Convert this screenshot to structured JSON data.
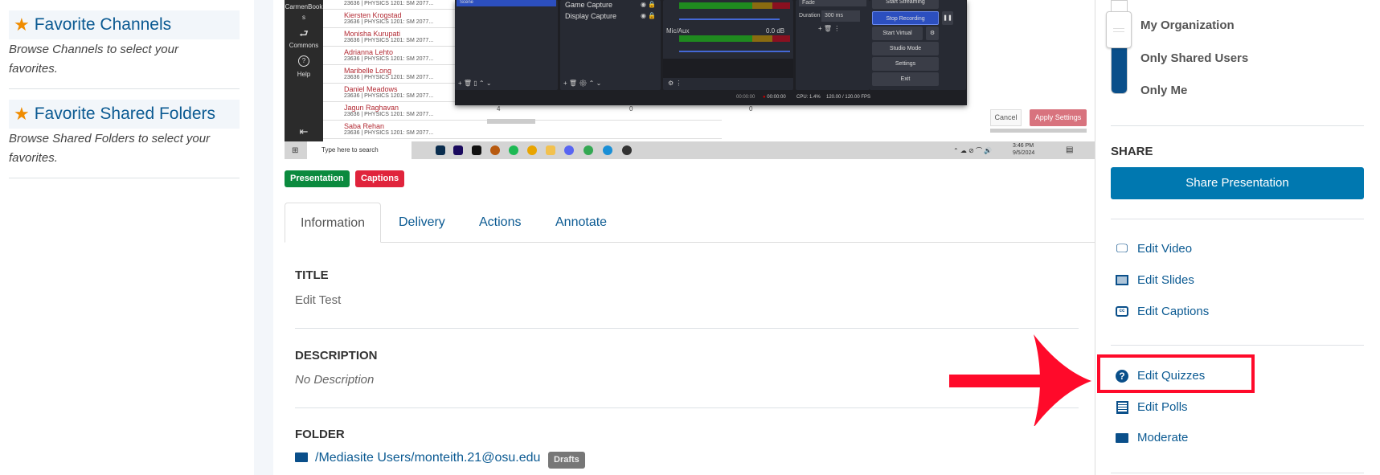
{
  "left_panel": {
    "favorites": [
      {
        "title": "Favorite Channels",
        "desc_line1": "Browse Channels to select your",
        "desc_line2": "favorites."
      },
      {
        "title": "Favorite Shared Folders",
        "desc_line1": "Browse Shared Folders to select your",
        "desc_line2": "favorites."
      }
    ]
  },
  "thumbnail": {
    "sidebar": {
      "item1a": "CarmenBook",
      "item1b": "s",
      "item2": "Commons",
      "item3": "Help"
    },
    "rows": [
      {
        "name": "",
        "sub": "23636 | PHYSICS 1201: SM 2077..."
      },
      {
        "name": "Kiersten Krogstad",
        "sub": "23636 | PHYSICS 1201: SM 2077..."
      },
      {
        "name": "Monisha Kurupati",
        "sub": "23636 | PHYSICS 1201: SM 2077..."
      },
      {
        "name": "Adrianna Lehto",
        "sub": "23636 | PHYSICS 1201: SM 2077..."
      },
      {
        "name": "Maribelle Long",
        "sub": "23636 | PHYSICS 1201: SM 2077..."
      },
      {
        "name": "Daniel Meadows",
        "sub": "23636 | PHYSICS 1201: SM 2077..."
      },
      {
        "name": "Jagun Raghavan",
        "sub": "23636 | PHYSICS 1201: SM 2077..."
      },
      {
        "name": "Saba Rehan",
        "sub": "23636 | PHYSICS 1201: SM 2077...",
        "c1": "4",
        "c2": "0",
        "c3": "0"
      }
    ],
    "obs": {
      "scene": "Scene",
      "sources": [
        "Game Capture",
        "Display Capture"
      ],
      "mixer_label": "Mic/Aux",
      "mixer_db": "0.0 dB",
      "transition": "Fade",
      "duration_label": "Duration",
      "duration": "300 ms",
      "controls": [
        "Start Streaming",
        "Stop Recording",
        "Start Virtual Camera",
        "Studio Mode",
        "Settings",
        "Exit"
      ],
      "status": {
        "stream_time": "00:00:00",
        "rec_time": "00:00:00",
        "cpu": "CPU: 1.4%",
        "fps": "120.00 / 120.00 FPS"
      }
    },
    "cancel": "Cancel",
    "apply": "Apply Settings",
    "taskbar": {
      "search": "Type here to search",
      "time": "3:46 PM",
      "date": "9/5/2024"
    }
  },
  "badges": {
    "presentation": "Presentation",
    "captions": "Captions",
    "presentation_color": "#0b8a3e",
    "captions_color": "#e0243c"
  },
  "tabs": [
    "Information",
    "Delivery",
    "Actions",
    "Annotate"
  ],
  "details": {
    "title_label": "TITLE",
    "title": "Edit Test",
    "description_label": "DESCRIPTION",
    "description": "No Description",
    "folder_label": "FOLDER",
    "folder": "/Mediasite Users/monteith.21@osu.edu",
    "folder_badge": "Drafts"
  },
  "right_panel": {
    "visibility": {
      "options": [
        "My Organization",
        "Only Shared Users",
        "Only Me"
      ],
      "selected": "My Organization"
    },
    "share_heading": "SHARE",
    "share_button": "Share Presentation",
    "edit_links": [
      {
        "label": "Edit Video",
        "icon": "monitor-icon"
      },
      {
        "label": "Edit Slides",
        "icon": "image-icon"
      },
      {
        "label": "Edit Captions",
        "icon": "closed-captions-icon"
      }
    ],
    "interactive_links": [
      {
        "label": "Edit Quizzes",
        "icon": "question-circle-icon",
        "highlighted": true
      },
      {
        "label": "Edit Polls",
        "icon": "list-icon"
      },
      {
        "label": "Moderate",
        "icon": "comment-icon"
      }
    ],
    "accent": "#0078b0",
    "highlight_color": "#ff0a2a"
  }
}
